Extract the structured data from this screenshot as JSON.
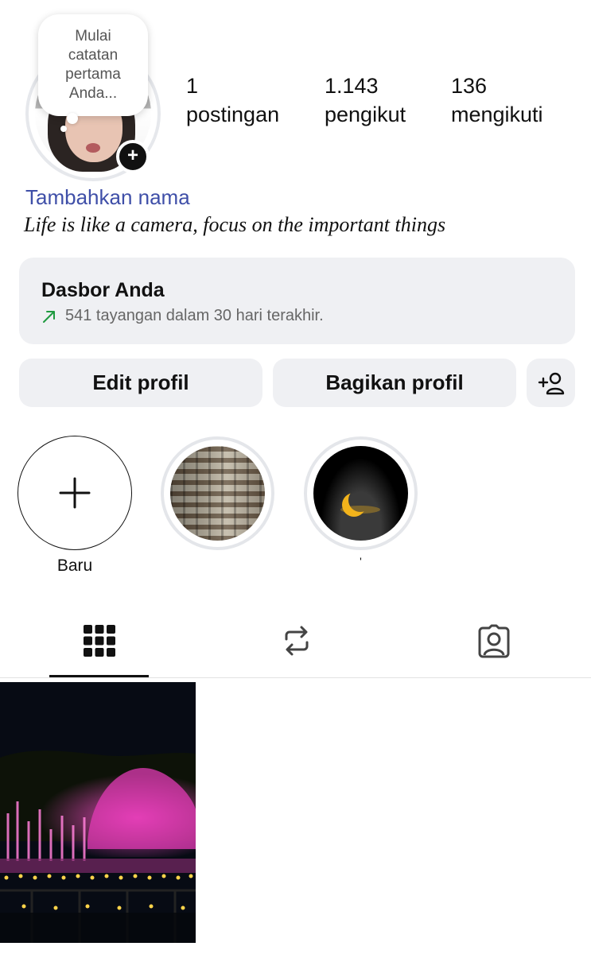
{
  "profile": {
    "note_text": "Mulai catatan pertama Anda...",
    "note_lines": [
      "Mulai",
      "catatan",
      "pertama",
      "Anda..."
    ],
    "add_name_link": "Tambahkan nama",
    "bio": "Life is like a camera, focus on the important things"
  },
  "stats": [
    {
      "value": "1",
      "label": "postingan"
    },
    {
      "value": "1.143",
      "label": "pengikut"
    },
    {
      "value": "136",
      "label": "mengikuti"
    }
  ],
  "dashboard": {
    "title": "Dasbor Anda",
    "subtitle": "541 tayangan dalam 30 hari terakhir.",
    "trend_color": "#1f9a3f"
  },
  "buttons": {
    "edit": "Edit profil",
    "share": "Bagikan profil",
    "add_person_icon": "add-person-icon"
  },
  "highlights": [
    {
      "label": "Baru",
      "icon": "plus-icon"
    },
    {
      "label": ""
    },
    {
      "label": "'"
    }
  ],
  "tabs": [
    {
      "icon": "grid-icon",
      "active": true
    },
    {
      "icon": "reels-repost-icon",
      "active": false
    },
    {
      "icon": "tagged-person-icon",
      "active": false
    }
  ],
  "colors": {
    "link": "#3f4fa8",
    "button_bg": "#eff0f3",
    "text": "#111111"
  }
}
